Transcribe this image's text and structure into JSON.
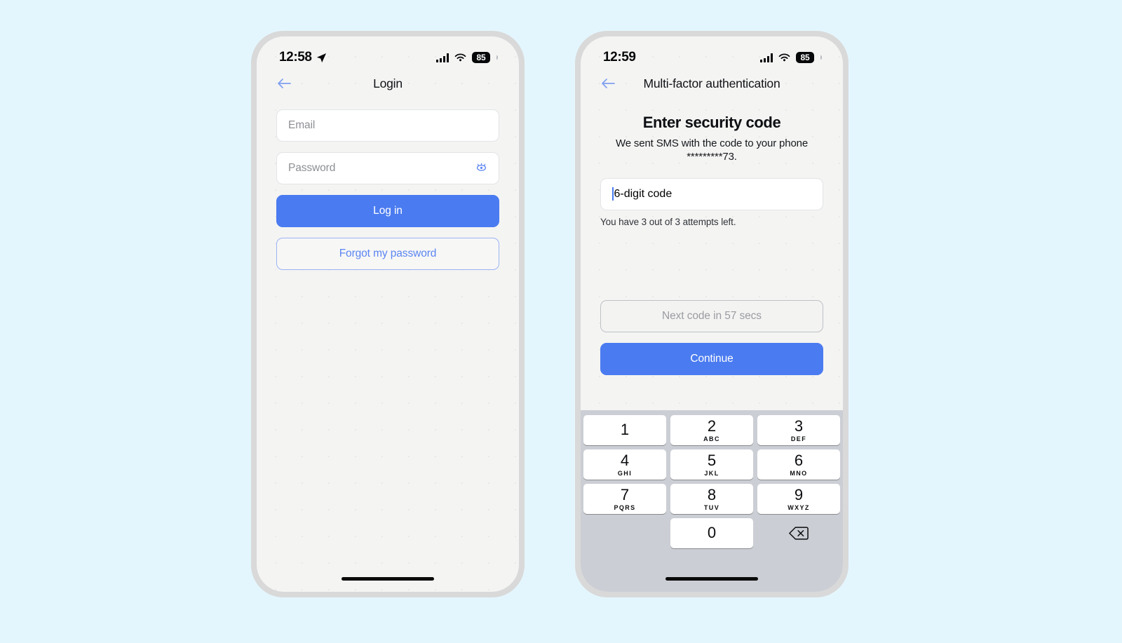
{
  "background_color": "#e4f6fd",
  "accent_color": "#4a7bf0",
  "phones": {
    "login": {
      "status_bar": {
        "time": "12:58",
        "location_icon": "location-arrow-icon",
        "cellular_icon": "cellular-bars-icon",
        "wifi_icon": "wifi-icon",
        "battery_level": "85"
      },
      "nav": {
        "back_icon": "back-arrow-icon",
        "title": "Login"
      },
      "form": {
        "email_placeholder": "Email",
        "password_placeholder": "Password",
        "show_password_icon": "eye-icon",
        "login_label": "Log in",
        "forgot_label": "Forgot my password"
      }
    },
    "mfa": {
      "status_bar": {
        "time": "12:59",
        "cellular_icon": "cellular-bars-icon",
        "wifi_icon": "wifi-icon",
        "battery_level": "85"
      },
      "nav": {
        "back_icon": "back-arrow-icon",
        "title": "Multi-factor authentication"
      },
      "body": {
        "heading": "Enter security code",
        "subtitle": "We sent SMS with the code to your phone *********73.",
        "code_placeholder": "6-digit code",
        "attempts_text": "You have 3 out of 3 attempts left.",
        "resend_label": "Next code in 57 secs",
        "continue_label": "Continue"
      },
      "keypad": {
        "keys": [
          {
            "num": "1",
            "sub": ""
          },
          {
            "num": "2",
            "sub": "ABC"
          },
          {
            "num": "3",
            "sub": "DEF"
          },
          {
            "num": "4",
            "sub": "GHI"
          },
          {
            "num": "5",
            "sub": "JKL"
          },
          {
            "num": "6",
            "sub": "MNO"
          },
          {
            "num": "7",
            "sub": "PQRS"
          },
          {
            "num": "8",
            "sub": "TUV"
          },
          {
            "num": "9",
            "sub": "WXYZ"
          },
          {
            "num": "0",
            "sub": ""
          }
        ],
        "delete_icon": "backspace-icon"
      }
    }
  }
}
